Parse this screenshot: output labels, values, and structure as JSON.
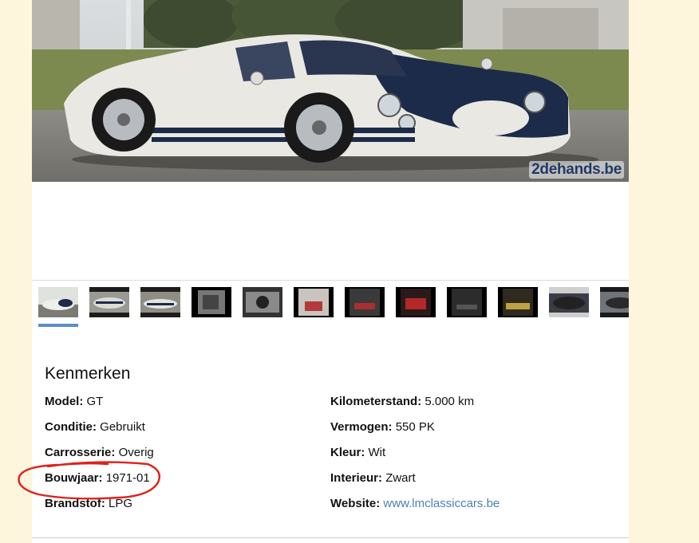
{
  "watermark": "2dehands.be",
  "thumbnails": [
    {
      "name": "thumb-1",
      "active": true
    },
    {
      "name": "thumb-2"
    },
    {
      "name": "thumb-3"
    },
    {
      "name": "thumb-4"
    },
    {
      "name": "thumb-5"
    },
    {
      "name": "thumb-6"
    },
    {
      "name": "thumb-7"
    },
    {
      "name": "thumb-8"
    },
    {
      "name": "thumb-9"
    },
    {
      "name": "thumb-10"
    },
    {
      "name": "thumb-11"
    },
    {
      "name": "thumb-12"
    }
  ],
  "specs": {
    "title": "Kenmerken",
    "model": {
      "label": "Model:",
      "value": "GT"
    },
    "conditie": {
      "label": "Conditie:",
      "value": "Gebruikt"
    },
    "carrosserie": {
      "label": "Carrosserie:",
      "value": "Overig"
    },
    "bouwjaar": {
      "label": "Bouwjaar:",
      "value": "1971-01"
    },
    "brandstof": {
      "label": "Brandstof:",
      "value": "LPG"
    },
    "kilometerstand": {
      "label": "Kilometerstand:",
      "value": "5.000 km"
    },
    "vermogen": {
      "label": "Vermogen:",
      "value": "550 PK"
    },
    "kleur": {
      "label": "Kleur:",
      "value": "Wit"
    },
    "interieur": {
      "label": "Interieur:",
      "value": "Zwart"
    },
    "website": {
      "label": "Website:",
      "value": "www.lmclassiccars.be"
    }
  },
  "colors": {
    "page_bg": "#fdf6dc",
    "link": "#4f7fb8",
    "active_thumb_bar": "#5a8fc8",
    "annotation": "#e0201a"
  }
}
